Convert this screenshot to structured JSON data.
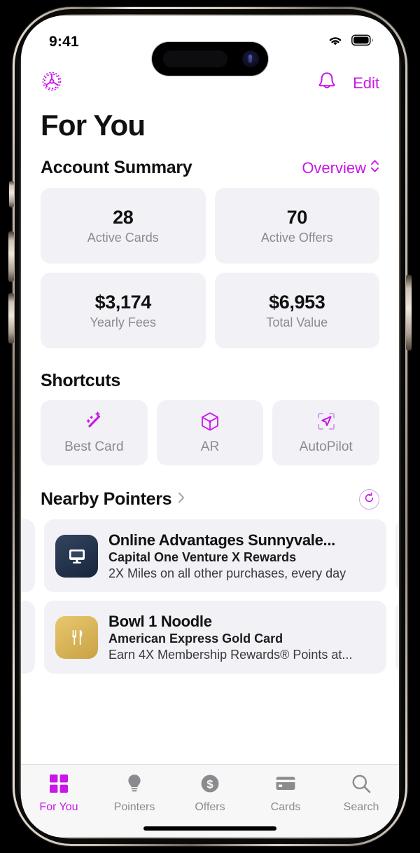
{
  "status_bar": {
    "time": "9:41",
    "wifi_icon": "wifi-icon",
    "battery_icon": "battery-icon"
  },
  "nav": {
    "settings_icon": "gear-icon",
    "notifications_icon": "bell-icon",
    "edit_label": "Edit"
  },
  "page": {
    "title": "For You"
  },
  "account_summary": {
    "section_title": "Account Summary",
    "selector_label": "Overview",
    "selector_icon": "chevron-up-down-icon",
    "stats": [
      {
        "value": "28",
        "label": "Active Cards"
      },
      {
        "value": "70",
        "label": "Active Offers"
      },
      {
        "value": "$3,174",
        "label": "Yearly Fees"
      },
      {
        "value": "$6,953",
        "label": "Total Value"
      }
    ]
  },
  "shortcuts": {
    "section_title": "Shortcuts",
    "items": [
      {
        "label": "Best Card",
        "icon": "magic-wand-sparkles-icon"
      },
      {
        "label": "AR",
        "icon": "cube-3d-icon"
      },
      {
        "label": "AutoPilot",
        "icon": "navigation-viewfinder-icon"
      }
    ]
  },
  "nearby_pointers": {
    "section_title": "Nearby Pointers",
    "chevron_icon": "chevron-right-icon",
    "refresh_icon": "refresh-icon",
    "cards": [
      {
        "name": "Online Advantages Sunnyvale...",
        "card": "Capital One Venture X Rewards",
        "reward": "2X Miles on all other purchases, every day",
        "icon": "monitor-icon",
        "icon_style": "ic-blue"
      },
      {
        "name": "Bowl 1 Noodle",
        "card": "American Express Gold Card",
        "reward": "Earn 4X Membership Rewards® Points at...",
        "icon": "fork-knife-icon",
        "icon_style": "ic-gold"
      }
    ]
  },
  "tab_bar": {
    "tabs": [
      {
        "label": "For You",
        "icon": "grid-squares-icon",
        "active": true
      },
      {
        "label": "Pointers",
        "icon": "lightbulb-icon",
        "active": false
      },
      {
        "label": "Offers",
        "icon": "dollar-circle-icon",
        "active": false
      },
      {
        "label": "Cards",
        "icon": "credit-card-icon",
        "active": false
      },
      {
        "label": "Search",
        "icon": "search-icon",
        "active": false
      }
    ]
  },
  "colors": {
    "accent": "#c817e8",
    "card_bg": "#f1f1f6",
    "muted_text": "#8a8a8f"
  }
}
